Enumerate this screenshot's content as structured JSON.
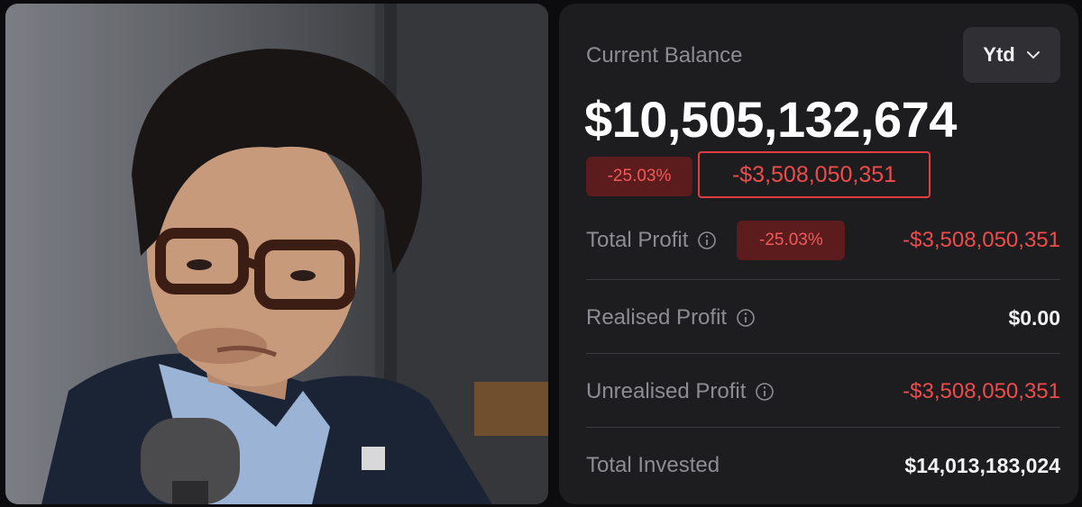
{
  "balance_card": {
    "title": "Current Balance",
    "period_selector": {
      "selected": "Ytd",
      "icon": "chevron-down-icon"
    },
    "balance": "$10,505,132,674",
    "change_pct": "-25.03%",
    "change_amount": "-$3,508,050,351",
    "rows": [
      {
        "label": "Total Profit",
        "badge": "-25.03%",
        "value": "-$3,508,050,351",
        "has_info": true
      },
      {
        "label": "Realised Profit",
        "value": "$0.00",
        "has_info": true
      },
      {
        "label": "Unrealised Profit",
        "value": "-$3,508,050,351",
        "has_info": true
      },
      {
        "label": "Total Invested",
        "value": "$14,013,183,024",
        "has_info": false
      }
    ]
  },
  "colors": {
    "negative": "#ee4b4b",
    "negative_badge_bg": "#5c1b1c",
    "card_bg": "#1d1d20"
  }
}
